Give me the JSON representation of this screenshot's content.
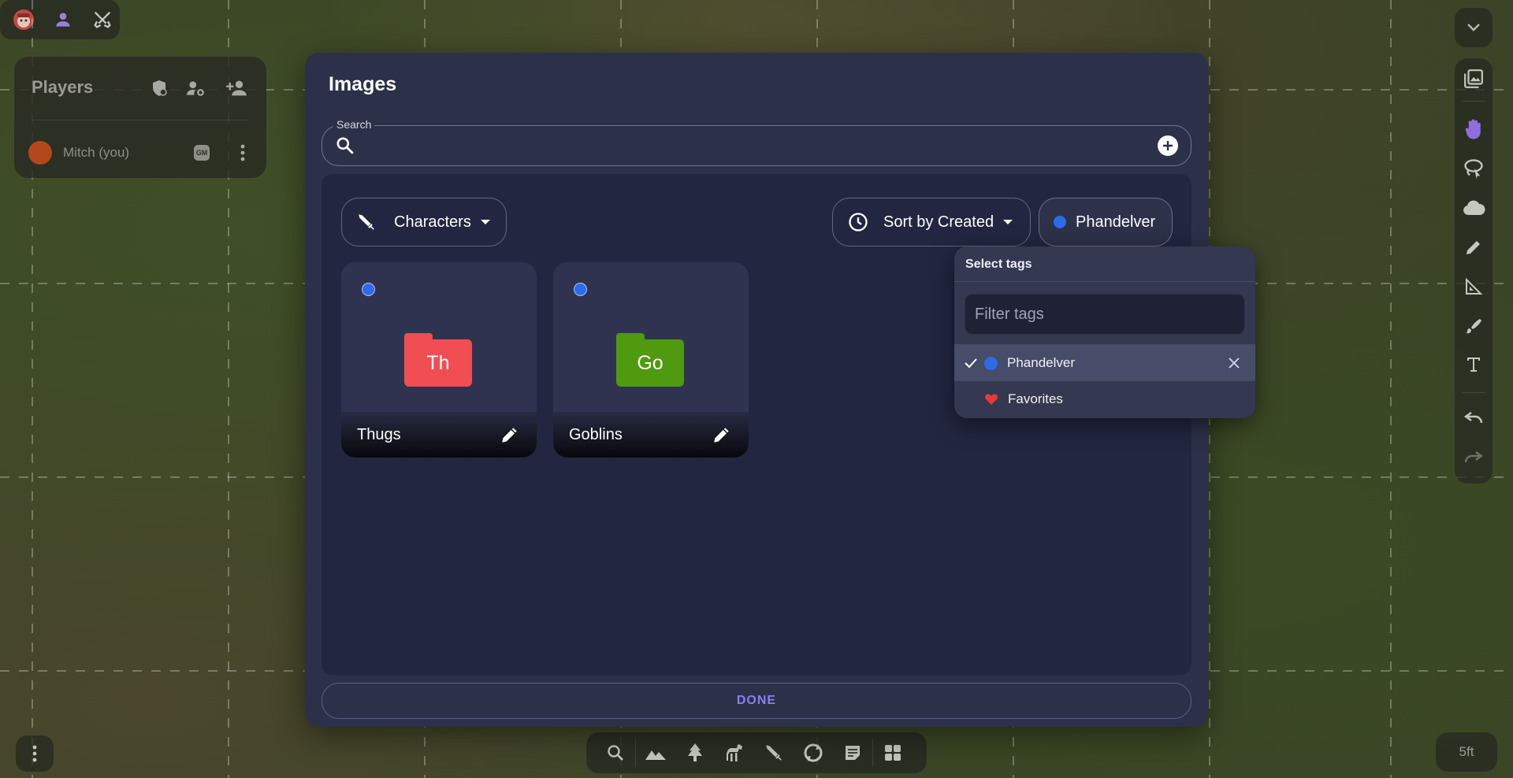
{
  "players_panel": {
    "title": "Players",
    "player": {
      "name": "Mitch (you)",
      "badge": "GM",
      "avatar_color": "#b5471d"
    }
  },
  "dialog": {
    "title": "Images",
    "search": {
      "label": "Search",
      "value": "",
      "placeholder": ""
    },
    "filters": {
      "category": "Characters",
      "sort": "Sort by Created",
      "tag": "Phandelver"
    },
    "items": [
      {
        "name": "Thugs",
        "initials": "Th",
        "folder_color": "#f04e52",
        "tag_color": "#2d6be8"
      },
      {
        "name": "Goblins",
        "initials": "Go",
        "folder_color": "#4f9a0e",
        "tag_color": "#2d6be8"
      }
    ],
    "done_label": "DONE"
  },
  "tag_menu": {
    "title": "Select tags",
    "filter_placeholder": "Filter tags",
    "options": [
      {
        "label": "Phandelver",
        "selected": true,
        "color": "#2d6be8"
      },
      {
        "label": "Favorites",
        "selected": false,
        "color": "#e53a3a"
      }
    ]
  },
  "scale_label": "5ft",
  "colors": {
    "accent": "#8b7ff0",
    "dialog_bg": "#2c3049",
    "tag_blue": "#2d6be8"
  }
}
